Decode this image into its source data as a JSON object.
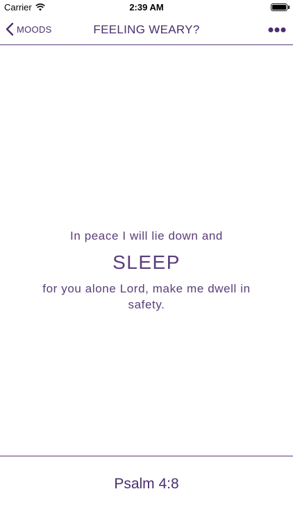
{
  "status_bar": {
    "carrier": "Carrier",
    "time": "2:39 AM",
    "battery_level": 1.0
  },
  "nav": {
    "back_label": "MOODS",
    "title": "FEELING WEARY?",
    "back_icon": "chevron-left-icon",
    "more_icon": "ellipsis-icon"
  },
  "verse": {
    "line1": "In peace I will lie down and",
    "keyword": "SLEEP",
    "line2": "for you alone Lord, make me dwell in safety."
  },
  "footer": {
    "reference": "Psalm 4:8"
  },
  "colors": {
    "accent": "#4a2e6e",
    "background": "#ffffff"
  }
}
